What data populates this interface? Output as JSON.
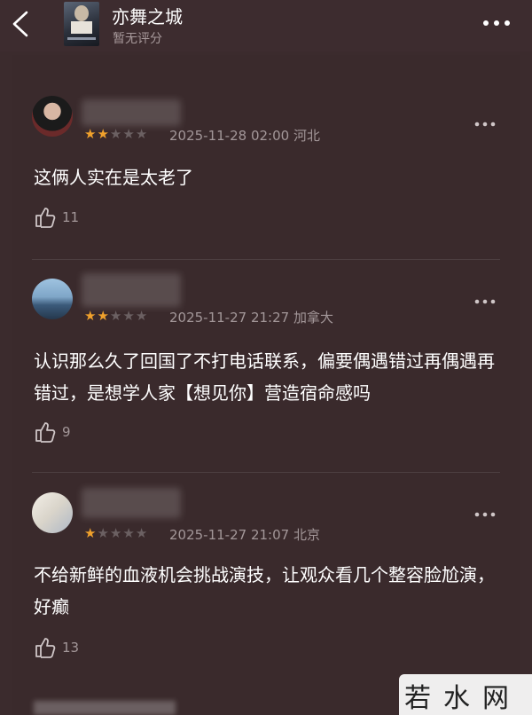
{
  "header": {
    "title": "亦舞之城",
    "score": "暂无评分"
  },
  "colors": {
    "star_on": "#f0a12c",
    "star_off": "#6b6062",
    "background": "#3b2b2d"
  },
  "reviews": [
    {
      "rating": 2,
      "max_rating": 5,
      "date": "2025-11-28 02:00",
      "location": "河北",
      "text": "这俩人实在是太老了",
      "likes": "11"
    },
    {
      "rating": 2,
      "max_rating": 5,
      "date": "2025-11-27 21:27",
      "location": "加拿大",
      "text": "认识那么久了回国了不打电话联系，偏要偶遇错过再偶遇再错过，是想学人家【想见你】营造宿命感吗",
      "likes": "9"
    },
    {
      "rating": 1,
      "max_rating": 5,
      "date": "2025-11-27 21:07",
      "location": "北京",
      "text": "不给新鲜的血液机会挑战演技，让观众看几个整容脸尬演，好癫",
      "likes": "13"
    }
  ],
  "watermark": {
    "text": "若水网"
  }
}
